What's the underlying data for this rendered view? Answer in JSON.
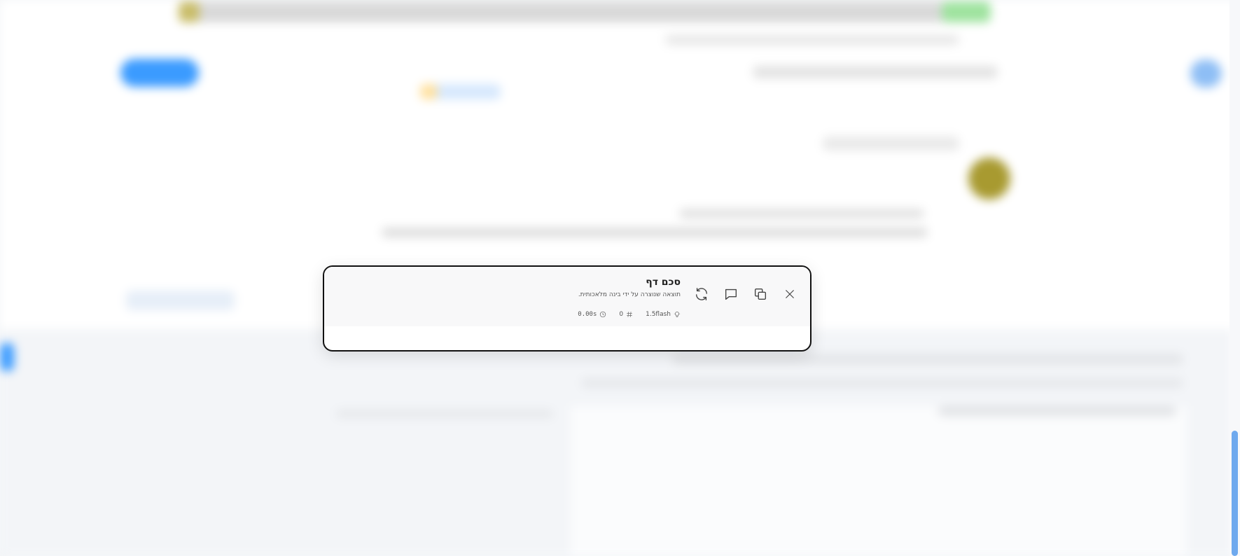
{
  "summary_panel": {
    "title": "סכם דף",
    "subtitle": "תוצאה שנוצרה על ידי בינה מלאכותית.",
    "stats": {
      "model": "1.5flash",
      "count": "0",
      "duration": "0.00s"
    },
    "actions": {
      "close_icon": "close-icon",
      "copy_icon": "copy-icon",
      "comment_icon": "comment-icon",
      "refresh_icon": "refresh-icon"
    }
  },
  "colors": {
    "accent": "#1e90ff",
    "scrollbar": "#6ea9ee",
    "panel_border": "#111111"
  }
}
